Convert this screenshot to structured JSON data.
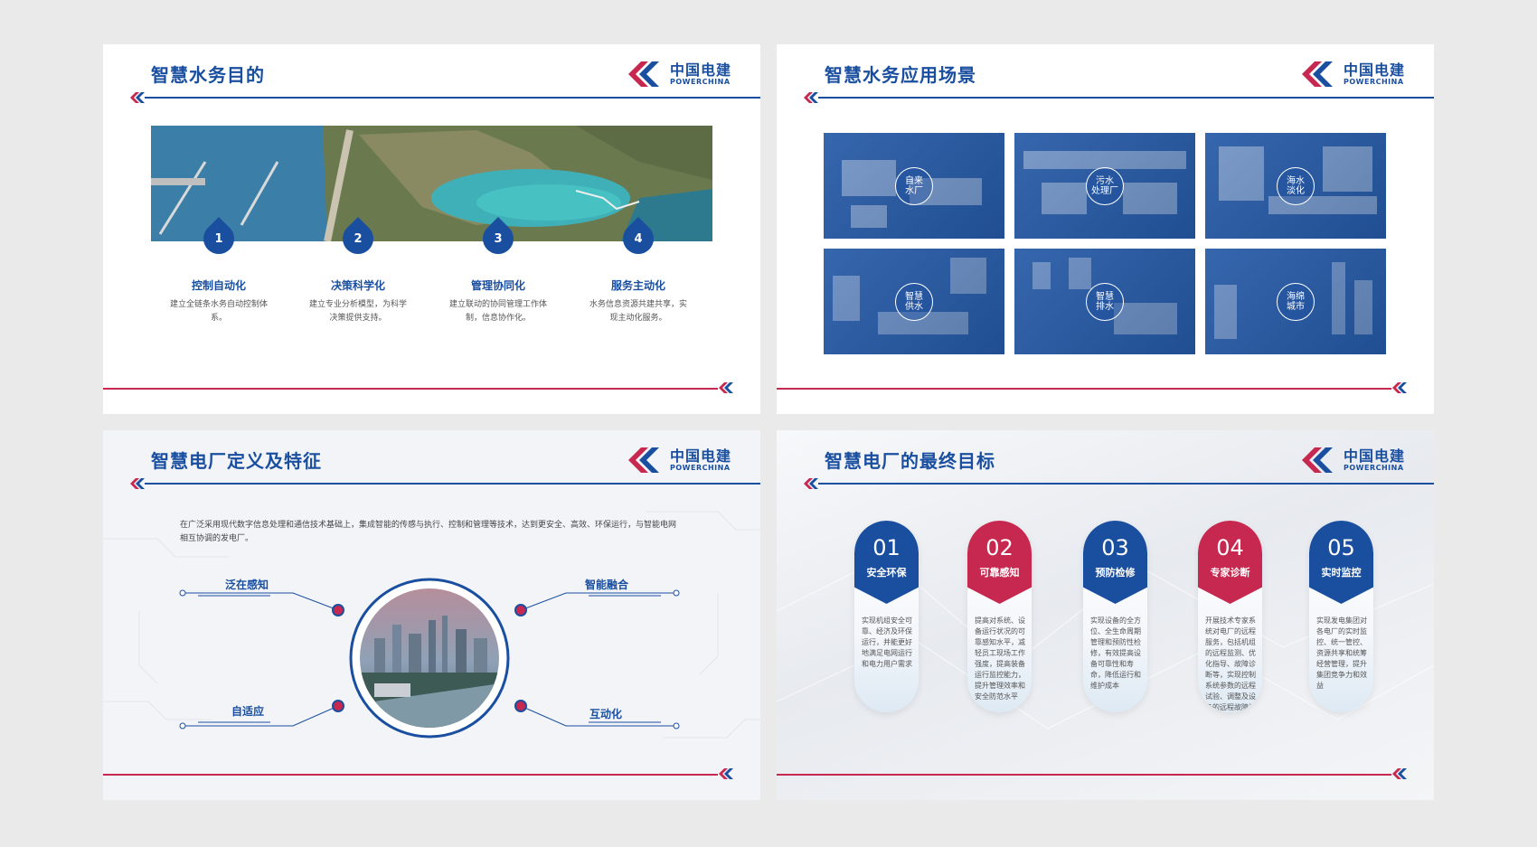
{
  "brand": {
    "name_cn": "中国电建",
    "name_en": "POWERCHINA",
    "colors": {
      "blue": "#1a4fa0",
      "red": "#c62850"
    }
  },
  "slide1": {
    "title": "智慧水务目的",
    "items": [
      {
        "num": "1",
        "title": "控制自动化",
        "desc": "建立全链条水务自动控制体系。"
      },
      {
        "num": "2",
        "title": "决策科学化",
        "desc": "建立专业分析模型，为科学决策提供支持。"
      },
      {
        "num": "3",
        "title": "管理协同化",
        "desc": "建立联动的协同管理工作体制，信息协作化。"
      },
      {
        "num": "4",
        "title": "服务主动化",
        "desc": "水务信息资源共建共享，实现主动化服务。"
      }
    ]
  },
  "slide2": {
    "title": "智慧水务应用场景",
    "tiles": [
      {
        "line1": "自来",
        "line2": "水厂"
      },
      {
        "line1": "污水",
        "line2": "处理厂"
      },
      {
        "line1": "海水",
        "line2": "淡化"
      },
      {
        "line1": "智慧",
        "line2": "供水"
      },
      {
        "line1": "智慧",
        "line2": "排水"
      },
      {
        "line1": "海绵",
        "line2": "城市"
      }
    ]
  },
  "slide3": {
    "title": "智慧电厂定义及特征",
    "intro": "在广泛采用现代数字信息处理和通信技术基础上，集成智能的传感与执行、控制和管理等技术，达到更安全、高效、环保运行，与智能电网相互协调的发电厂。",
    "features": {
      "tl": "泛在感知",
      "tr": "智能融合",
      "bl": "自适应",
      "br": "互动化"
    }
  },
  "slide4": {
    "title": "智慧电厂的最终目标",
    "pills": [
      {
        "num": "01",
        "label": "安全环保",
        "color": "#1a4fa0",
        "text": "实现机组安全可靠、经济及环保运行，并能更好地满足电网运行和电力用户需求"
      },
      {
        "num": "02",
        "label": "可靠感知",
        "color": "#c62850",
        "text": "提高对系统、设备运行状况的可靠感知水平，减轻员工现场工作强度，提高装备运行监控能力，提升管理效率和安全防范水平"
      },
      {
        "num": "03",
        "label": "预防检修",
        "color": "#1a4fa0",
        "text": "实现设备的全方位、全生命周期管理和预防性检修，有效提高设备可靠性和寿命，降低运行和维护成本"
      },
      {
        "num": "04",
        "label": "专家诊断",
        "color": "#c62850",
        "text": "开展技术专家系统对电厂的远程服务，包括机组的远程监测、优化指导、故障诊断等，实现控制系统参数的远程试验、调整及设备的远程故障诊断"
      },
      {
        "num": "05",
        "label": "实时监控",
        "color": "#1a4fa0",
        "text": "实现发电集团对各电厂的实时监控、统一管控、资源共享和统筹经营管理，提升集团竞争力和效益"
      }
    ]
  }
}
